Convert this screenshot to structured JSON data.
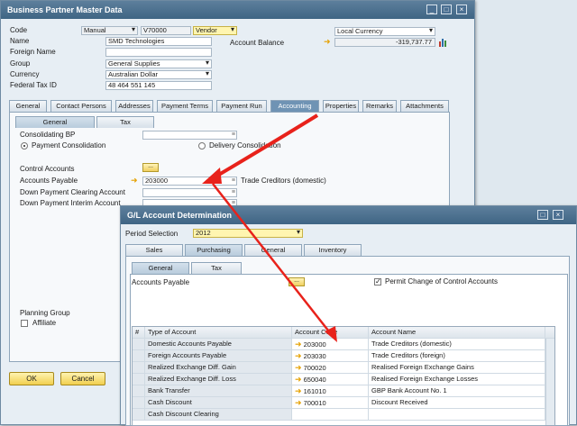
{
  "bp_window": {
    "title": "Business Partner Master Data",
    "controls": [
      "_",
      "□",
      "×"
    ],
    "code_label": "Code",
    "code_series": "Manual",
    "code_value": "V70000",
    "bp_type": "Vendor",
    "name_label": "Name",
    "name_value": "SMD Technologies",
    "foreign_name_label": "Foreign Name",
    "group_label": "Group",
    "group_value": "General Supplies",
    "currency_label": "Currency",
    "currency_value": "Australian Dollar",
    "federal_tax_label": "Federal Tax ID",
    "federal_tax_value": "48 464 551 145",
    "currency_display": "Local Currency",
    "account_balance_label": "Account Balance",
    "account_balance_value": "-319,737.77",
    "tabs": [
      "General",
      "Contact Persons",
      "Addresses",
      "Payment Terms",
      "Payment Run",
      "Accounting",
      "Properties",
      "Remarks",
      "Attachments"
    ],
    "subtabs": [
      "General",
      "Tax"
    ],
    "consolidating_bp_label": "Consolidating BP",
    "payment_consolidation_label": "Payment Consolidation",
    "delivery_consolidation_label": "Delivery Consolidation",
    "control_accounts_label": "Control Accounts",
    "control_accounts_btn": "...",
    "accounts_payable_label": "Accounts Payable",
    "accounts_payable_value": "203000",
    "accounts_payable_name": "Trade Creditors (domestic)",
    "dp_clearing_label": "Down Payment Clearing Account",
    "dp_interim_label": "Down Payment Interim Account",
    "planning_group_label": "Planning Group",
    "affiliate_label": "Affiliate",
    "ok_label": "OK",
    "cancel_label": "Cancel"
  },
  "gl_window": {
    "title": "G/L Account Determination",
    "controls": [
      "□",
      "×"
    ],
    "period_label": "Period Selection",
    "period_value": "2012",
    "tabs": [
      "Sales",
      "Purchasing",
      "General",
      "Inventory"
    ],
    "subtabs": [
      "General",
      "Tax"
    ],
    "accounts_payable_label": "Accounts Payable",
    "ap_btn": "...",
    "permit_change_label": "Permit Change of Control Accounts",
    "columns": [
      "#",
      "Type of Account",
      "Account Code",
      "Account Name"
    ],
    "rows": [
      {
        "type": "Domestic Accounts Payable",
        "code": "203000",
        "name": "Trade Creditors (domestic)"
      },
      {
        "type": "Foreign Accounts Payable",
        "code": "203030",
        "name": "Trade Creditors (foreign)"
      },
      {
        "type": "Realized Exchange Diff. Gain",
        "code": "700020",
        "name": "Realised Foreign Exchange Gains"
      },
      {
        "type": "Realized Exchange Diff. Loss",
        "code": "650040",
        "name": "Realised Foreign Exchange Losses"
      },
      {
        "type": "Bank Transfer",
        "code": "161010",
        "name": "GBP Bank Account No. 1"
      },
      {
        "type": "Cash Discount",
        "code": "700010",
        "name": "Discount Received"
      },
      {
        "type": "Cash Discount Clearing",
        "code": "",
        "name": ""
      }
    ]
  },
  "colors": {
    "titlebar": "#4a6f8f",
    "active_tab": "#6f93b4",
    "yellow_field": "#fff5b0",
    "annotation_arrow": "#e8221b"
  }
}
